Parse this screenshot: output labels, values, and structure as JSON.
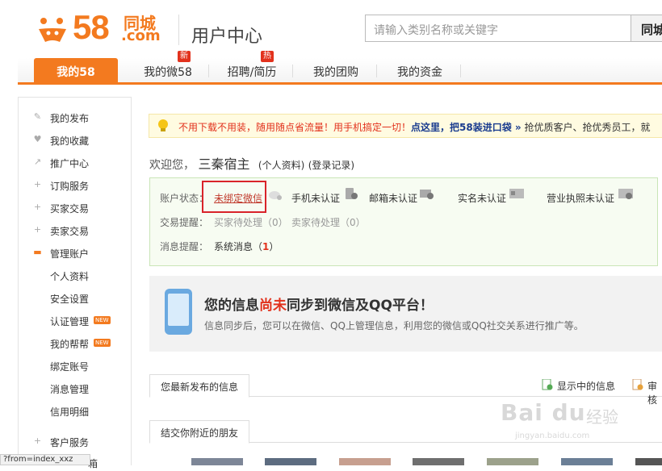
{
  "header": {
    "logo_num": "58",
    "logo_cn": "同城",
    "logo_com": ".com",
    "title": "用户中心",
    "search_placeholder": "请输入类别名称或关键字",
    "search_button": "同城"
  },
  "nav": {
    "tabs": [
      {
        "label": "我的58",
        "active": true
      },
      {
        "label": "我的微58",
        "badge": "新"
      },
      {
        "label": "招聘/简历",
        "badge": "热"
      },
      {
        "label": "我的团购"
      },
      {
        "label": "我的资金"
      }
    ]
  },
  "sidebar": {
    "items": [
      {
        "label": "我的发布",
        "icon": "edit-icon"
      },
      {
        "label": "我的收藏",
        "icon": "heart-icon"
      },
      {
        "label": "推广中心",
        "icon": "chart-icon"
      },
      {
        "label": "订购服务",
        "icon": "plus-icon"
      },
      {
        "label": "买家交易",
        "icon": "plus-icon"
      },
      {
        "label": "卖家交易",
        "icon": "plus-icon"
      },
      {
        "label": "管理账户",
        "icon": "minus-icon"
      }
    ],
    "subitems": [
      {
        "label": "个人资料"
      },
      {
        "label": "安全设置"
      },
      {
        "label": "认证管理",
        "tag": "NEW"
      },
      {
        "label": "我的帮帮",
        "tag": "NEW"
      },
      {
        "label": "绑定账号"
      },
      {
        "label": "消息管理"
      },
      {
        "label": "信用明细"
      }
    ],
    "bottom_item": {
      "label": "客户服务",
      "icon": "plus-icon"
    },
    "bottom_partial": "箱"
  },
  "notice": {
    "text_plain": "不用下载不用装，随用随点省流量！用手机搞定一切！",
    "text_link": "点这里，把58装进口袋 »",
    "text_tail": " 抢优质客户、抢优秀员工，就"
  },
  "welcome": {
    "prefix": "欢迎您，",
    "username": "三秦宿主",
    "profile_link": "(个人资料)",
    "login_log_link": "(登录记录)"
  },
  "status": {
    "account_label": "账户状态：",
    "wechat": "未绑定微信",
    "phone": "手机未认证",
    "email": "邮箱未认证",
    "realname": "实名未认证",
    "license": "营业执照未认证",
    "trade_label": "交易提醒：",
    "buyer_pending": "买家待处理（0）",
    "seller_pending": "卖家待处理（0）",
    "msg_label": "消息提醒：",
    "sys_msg": "系统消息（",
    "sys_msg_count": "1",
    "sys_msg_close": "）"
  },
  "sync": {
    "title_a": "您的信息",
    "title_b": "尚未",
    "title_c": "同步到微信及QQ平台！",
    "desc": "信息同步后，您可以在微信、QQ上管理信息，利用您的微信或QQ社交关系进行推广等。"
  },
  "sections": {
    "latest": "您最新发布的信息",
    "showing": "显示中的信息",
    "reviewing": "审核",
    "friends": "结交你附近的朋友"
  },
  "statusbar": {
    "url": "?from=index_xxz"
  },
  "watermark": {
    "brand": "Bai du",
    "cn": "经验",
    "domain": "jingyan.baidu.com"
  },
  "colors": {
    "brand": "#f37a1f",
    "alert": "#e2321d",
    "link": "#333333"
  }
}
